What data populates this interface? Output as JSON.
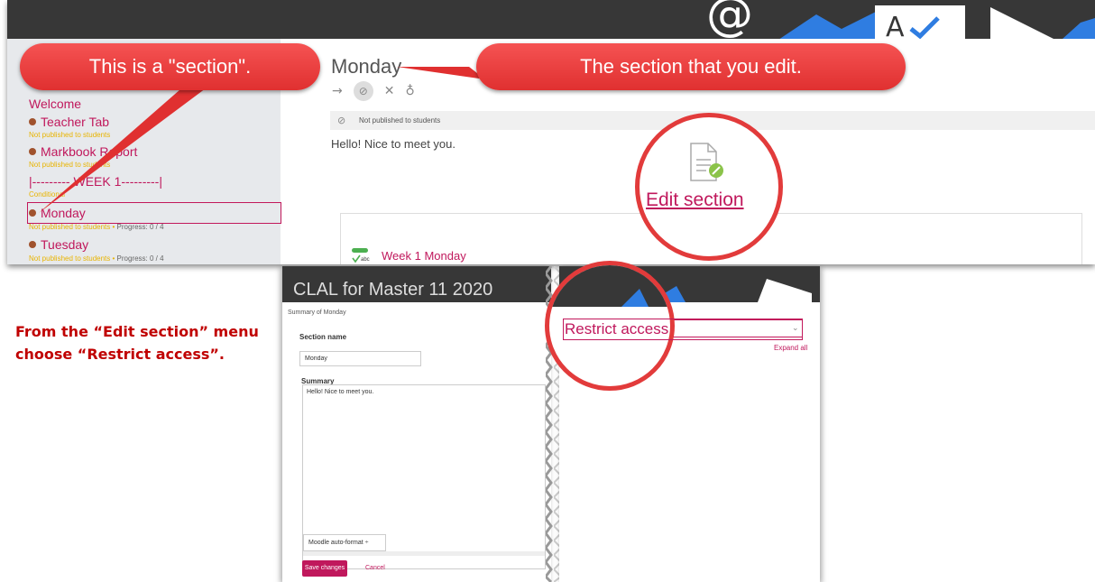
{
  "colors": {
    "accent": "#c0185c",
    "callout": "#e23b3b",
    "banner": "#373737",
    "nav_bg": "#e7e9ec",
    "unpublished": "#e8b400"
  },
  "callouts": {
    "section": "This is a \"section\".",
    "edit": "The section that you edit."
  },
  "banner_icons": [
    "at-sign-icon",
    "checkmark-icon",
    "a-letter-icon",
    "arrow-icon"
  ],
  "sidebar": {
    "welcome": "Welcome",
    "items": [
      {
        "label": "Teacher Tab",
        "sub": "Not published to students"
      },
      {
        "label": "Markbook Report",
        "sub": "Not published to students"
      },
      {
        "label": "|--------- WEEK 1---------|",
        "sub": "Conditional"
      },
      {
        "label": "Monday",
        "sub": "Not published to students",
        "progress": "Progress: 0 / 4"
      },
      {
        "label": "Tuesday",
        "sub": "Not published to students",
        "progress": "Progress: 0 / 4"
      }
    ]
  },
  "main": {
    "title": "Monday",
    "icons": [
      "arrow-right-icon",
      "eye-off-icon",
      "close-icon",
      "lightbulb-icon"
    ],
    "unpublished": "Not published to students",
    "greeting": "Hello! Nice to meet you.",
    "edit_section": "Edit section",
    "activity": "Week 1 Monday"
  },
  "instruction": {
    "line1": "From the “Edit section” menu",
    "line2": "choose “Restrict access”."
  },
  "form": {
    "course_title": "CLAL for Master 11 2020",
    "heading": "Summary of Monday",
    "section_name_label": "Section name",
    "section_name_value": "Monday",
    "summary_label": "Summary",
    "summary_text": "Hello! Nice to meet you.",
    "format": "Moodle auto-format ÷",
    "save": "Save changes",
    "cancel": "Cancel"
  },
  "settings": {
    "restrict_access": "Restrict access",
    "expand_all": "Expand all"
  }
}
